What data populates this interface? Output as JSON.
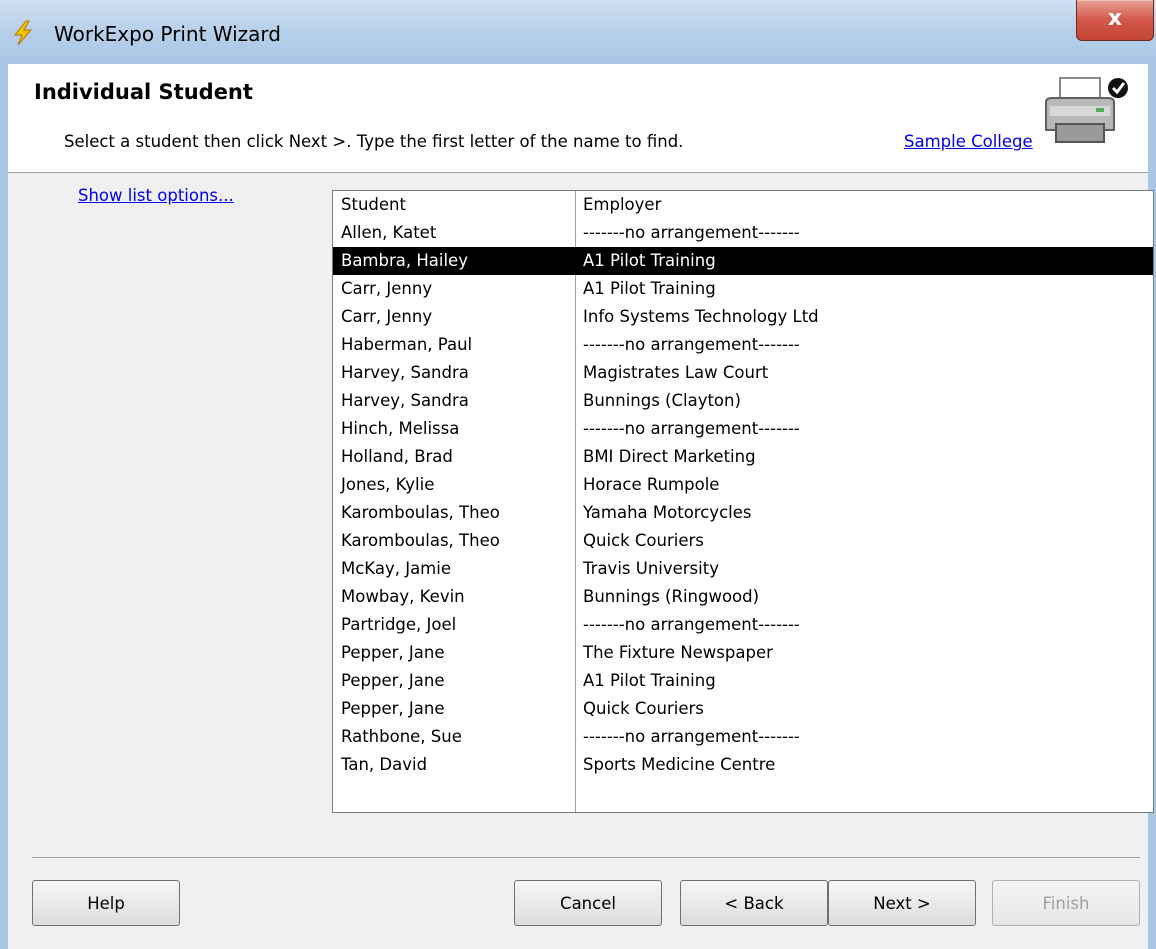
{
  "window": {
    "title": "WorkExpo Print Wizard",
    "close_glyph": "x",
    "icon": "lightning-bolt-icon"
  },
  "header": {
    "heading": "Individual Student",
    "instructions": "Select a student then click Next >. Type the first letter of the name to find.",
    "college_link": "Sample College",
    "icon": "printer-check-icon"
  },
  "list_options_link": "Show list options...",
  "list": {
    "columns": [
      "Student",
      "Employer"
    ],
    "selected_index": 1,
    "rows": [
      {
        "student": "Allen, Katet",
        "employer": " -------no arrangement-------"
      },
      {
        "student": "Bambra, Hailey",
        "employer": "A1 Pilot Training"
      },
      {
        "student": "Carr, Jenny",
        "employer": "A1 Pilot Training"
      },
      {
        "student": "Carr, Jenny",
        "employer": "Info Systems Technology Ltd"
      },
      {
        "student": "Haberman, Paul",
        "employer": " -------no arrangement-------"
      },
      {
        "student": "Harvey, Sandra",
        "employer": "Magistrates Law Court"
      },
      {
        "student": "Harvey, Sandra",
        "employer": "Bunnings (Clayton)"
      },
      {
        "student": "Hinch, Melissa",
        "employer": " -------no arrangement-------"
      },
      {
        "student": "Holland, Brad",
        "employer": "BMI Direct Marketing"
      },
      {
        "student": "Jones, Kylie",
        "employer": "Horace Rumpole"
      },
      {
        "student": "Karomboulas, Theo",
        "employer": "Yamaha Motorcycles"
      },
      {
        "student": "Karomboulas, Theo",
        "employer": "Quick Couriers"
      },
      {
        "student": "McKay, Jamie",
        "employer": "Travis University"
      },
      {
        "student": "Mowbay, Kevin",
        "employer": "Bunnings (Ringwood)"
      },
      {
        "student": "Partridge, Joel",
        "employer": " -------no arrangement-------"
      },
      {
        "student": "Pepper, Jane",
        "employer": "The Fixture Newspaper"
      },
      {
        "student": "Pepper, Jane",
        "employer": "A1 Pilot Training"
      },
      {
        "student": "Pepper, Jane",
        "employer": "Quick Couriers"
      },
      {
        "student": "Rathbone, Sue",
        "employer": " -------no arrangement-------"
      },
      {
        "student": "Tan, David",
        "employer": "Sports Medicine Centre"
      }
    ]
  },
  "buttons": {
    "help": "Help",
    "cancel": "Cancel",
    "back": "< Back",
    "next": "Next >",
    "finish": "Finish"
  },
  "colors": {
    "selection": "#000000",
    "link": "#0000ee",
    "titlebar": "#b9d1ea",
    "close_button": "#d3574a"
  }
}
